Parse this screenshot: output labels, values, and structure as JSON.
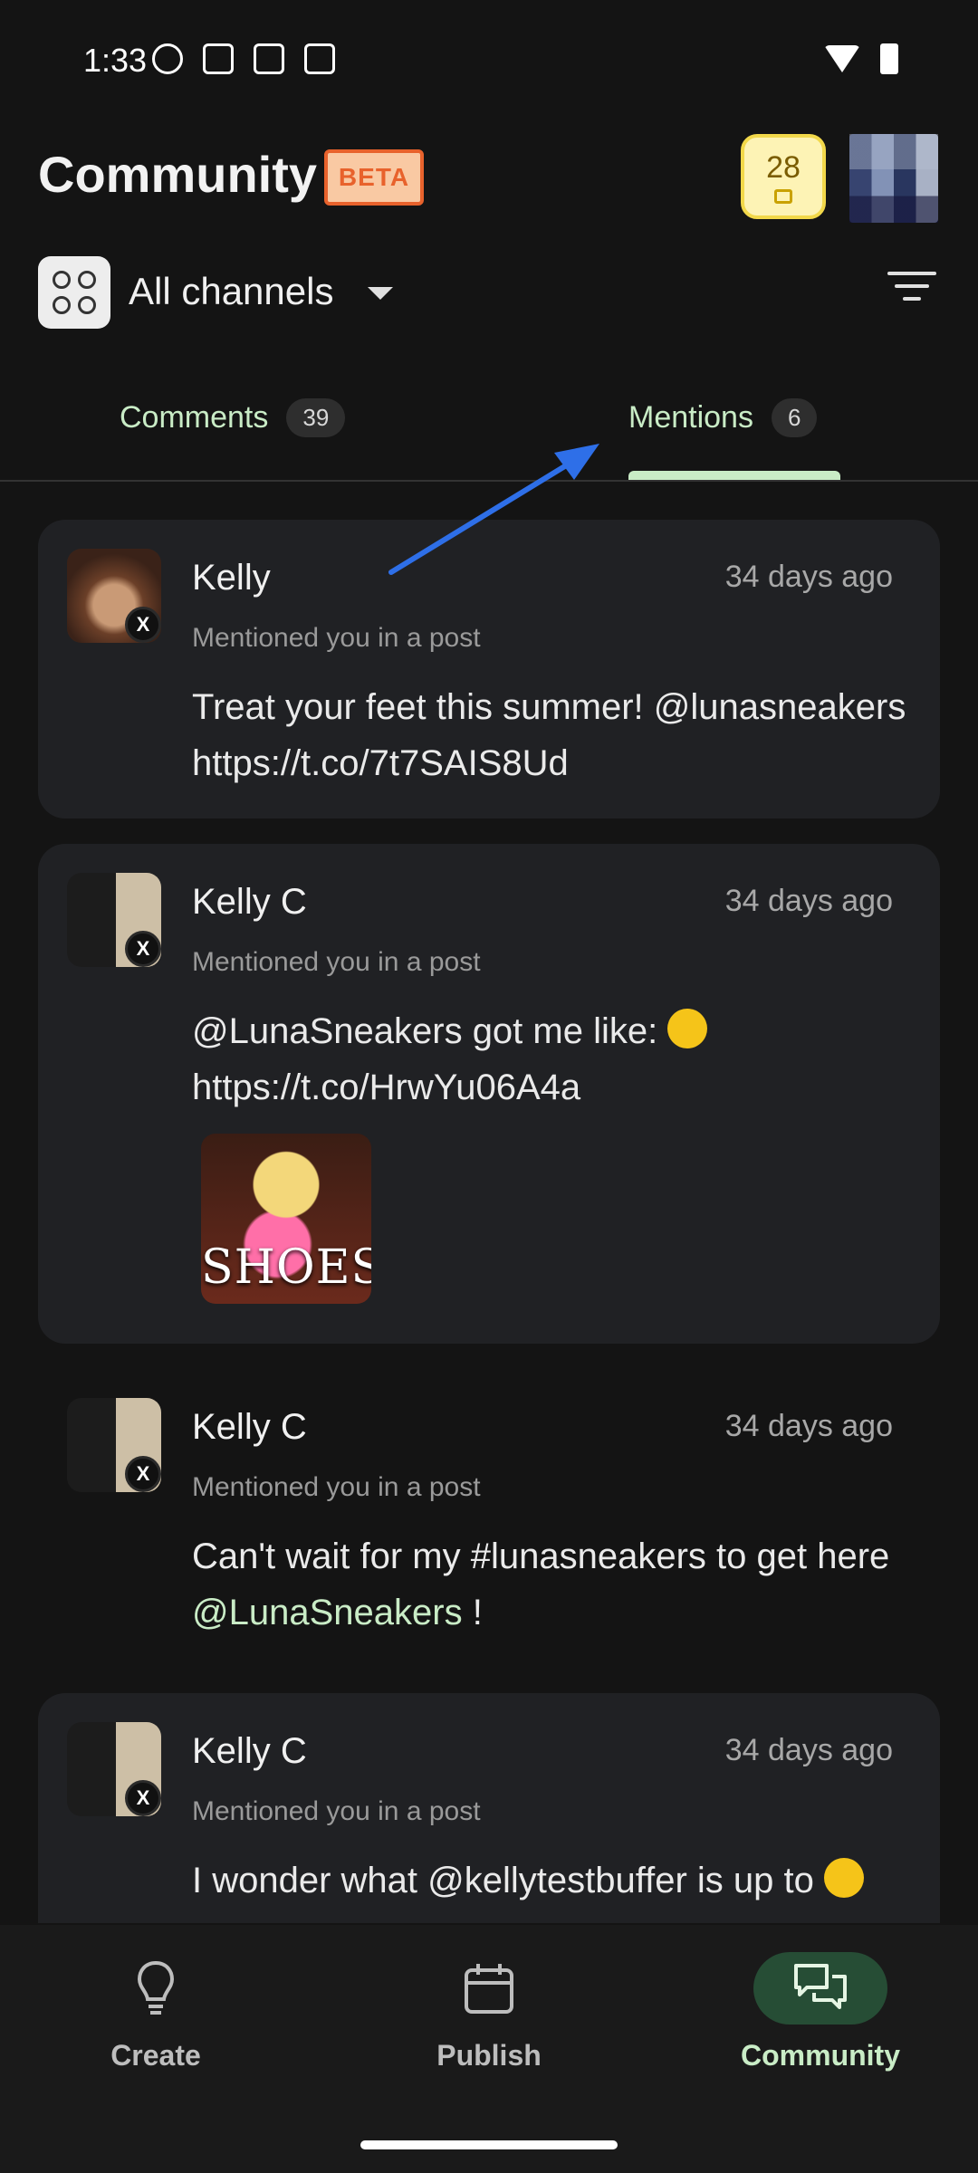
{
  "status_bar": {
    "time": "1:33"
  },
  "header": {
    "title": "Community",
    "beta_label": "BETA",
    "credits": "28"
  },
  "channel": {
    "label": "All channels"
  },
  "tabs": [
    {
      "label": "Comments",
      "count": "39"
    },
    {
      "label": "Mentions",
      "count": "6",
      "active": true
    }
  ],
  "mentions": [
    {
      "name": "Kelly",
      "time": "34 days ago",
      "subtitle": "Mentioned you in a post",
      "text": "Treat your feet this summer! @lunasneakers https://t.co/7t7SAIS8Ud"
    },
    {
      "name": "Kelly C",
      "time": "34 days ago",
      "subtitle": "Mentioned you in a post",
      "text_1": "@LunaSneakers got me like:",
      "text_2": "https://t.co/HrwYu06A4a",
      "media_caption": "SHOES"
    },
    {
      "name": "Kelly C",
      "time": "34 days ago",
      "subtitle": "Mentioned you in a post",
      "text_before": "Can't wait for my #lunasneakers to get here ",
      "mention": "@LunaSneakers",
      "text_after": " !"
    },
    {
      "name": "Kelly C",
      "time": "34 days ago",
      "subtitle": "Mentioned you in a post",
      "text": "I wonder what @kellytestbuffer is up to"
    }
  ],
  "bottom_nav": [
    {
      "label": "Create",
      "icon": "lightbulb-icon"
    },
    {
      "label": "Publish",
      "icon": "calendar-icon"
    },
    {
      "label": "Community",
      "icon": "chat-bubbles-icon",
      "active": true
    }
  ],
  "colors": {
    "accent": "#c9ecc6",
    "background": "#141414",
    "card": "#202124",
    "beta": "#e8622c"
  }
}
